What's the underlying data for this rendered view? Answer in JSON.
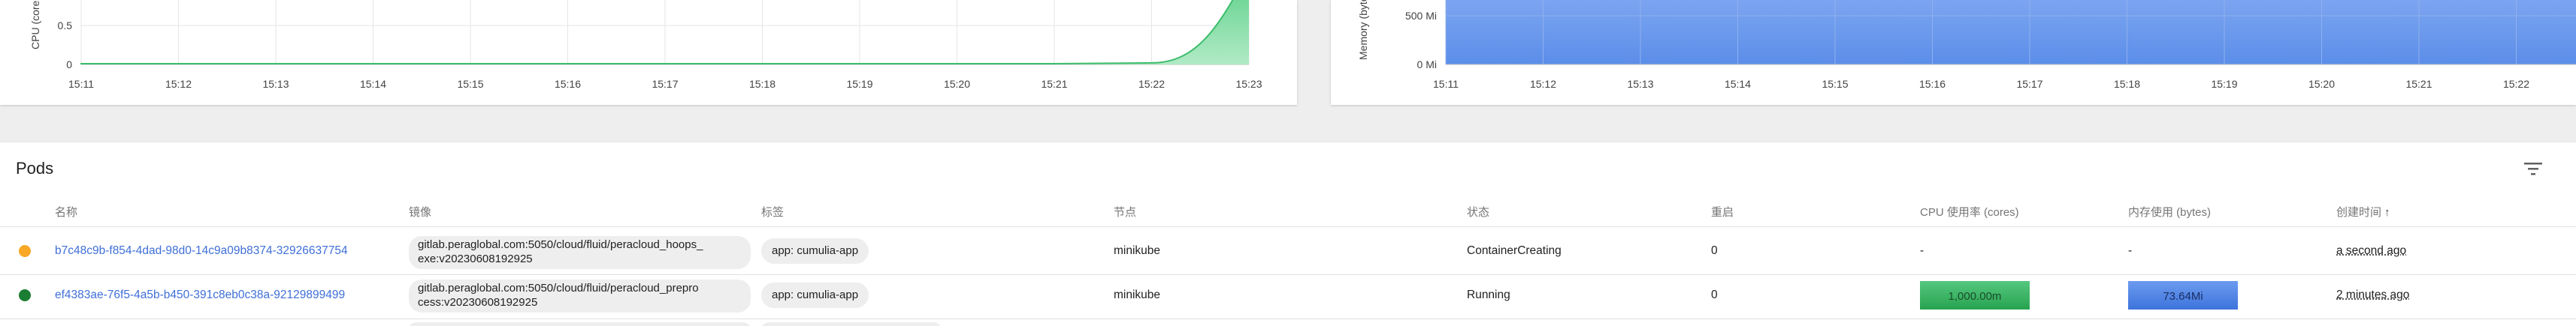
{
  "colors": {
    "link": "#3f6fd8",
    "pending": "#f9a825",
    "running": "#1b7d32",
    "cpu_fill": "#5fcf8a",
    "mem_fill": "#5b8ee9"
  },
  "cpu_chart": {
    "ylabel": "CPU (cores)",
    "yticks": [
      "0.5",
      "0"
    ],
    "xticks": [
      "15:11",
      "15:12",
      "15:13",
      "15:14",
      "15:15",
      "15:16",
      "15:17",
      "15:18",
      "15:19",
      "15:20",
      "15:21",
      "15:22",
      "15:23"
    ]
  },
  "mem_chart": {
    "ylabel": "Memory (bytes)",
    "yticks": [
      "500 Mi",
      "0 Mi"
    ],
    "xticks": [
      "15:11",
      "15:12",
      "15:13",
      "15:14",
      "15:15",
      "15:16",
      "15:17",
      "15:18",
      "15:19",
      "15:20",
      "15:21",
      "15:22"
    ]
  },
  "chart_data": [
    {
      "type": "area",
      "ylabel": "CPU (cores)",
      "x": [
        "15:11",
        "15:12",
        "15:13",
        "15:14",
        "15:15",
        "15:16",
        "15:17",
        "15:18",
        "15:19",
        "15:20",
        "15:21",
        "15:22",
        "15:23"
      ],
      "series": [
        {
          "values": [
            0.01,
            0.01,
            0.01,
            0.01,
            0.01,
            0.01,
            0.01,
            0.01,
            0.01,
            0.01,
            0.01,
            0.02,
            1.0
          ]
        }
      ]
    },
    {
      "type": "area",
      "ylabel": "Memory (bytes)",
      "x": [
        "15:11",
        "15:12",
        "15:13",
        "15:14",
        "15:15",
        "15:16",
        "15:17",
        "15:18",
        "15:19",
        "15:20",
        "15:21",
        "15:22"
      ],
      "series": [
        {
          "values": [
            800,
            800,
            800,
            800,
            800,
            800,
            800,
            800,
            800,
            800,
            800,
            800
          ]
        }
      ]
    }
  ],
  "pods": {
    "title": "Pods",
    "columns": {
      "name": "名称",
      "image": "镜像",
      "labels": "标签",
      "node": "节点",
      "status": "状态",
      "restarts": "重启",
      "cpu": "CPU 使用率 (cores)",
      "memory": "内存使用 (bytes)",
      "created": "创建时间"
    },
    "rows": [
      {
        "name": "b7c48c9b-f854-4dad-98d0-14c9a09b8374-32926637754",
        "image_line1": "gitlab.peraglobal.com:5050/cloud/fluid/peracloud_hoops_",
        "image_line2": "exe:v20230608192925",
        "label": "app: cumulia-app",
        "node": "minikube",
        "status": "ContainerCreating",
        "restarts": "0",
        "cpu": "-",
        "memory": "-",
        "created": "a second ago"
      },
      {
        "name": "ef4383ae-76f5-4a5b-b450-391c8eb0c38a-92129899499",
        "image_line1": "gitlab.peraglobal.com:5050/cloud/fluid/peracloud_prepro",
        "image_line2": "cess:v20230608192925",
        "label": "app: cumulia-app",
        "node": "minikube",
        "status": "Running",
        "restarts": "0",
        "cpu": "1,000.00m",
        "memory": "73.64Mi",
        "created": "2 minutes ago"
      }
    ]
  }
}
